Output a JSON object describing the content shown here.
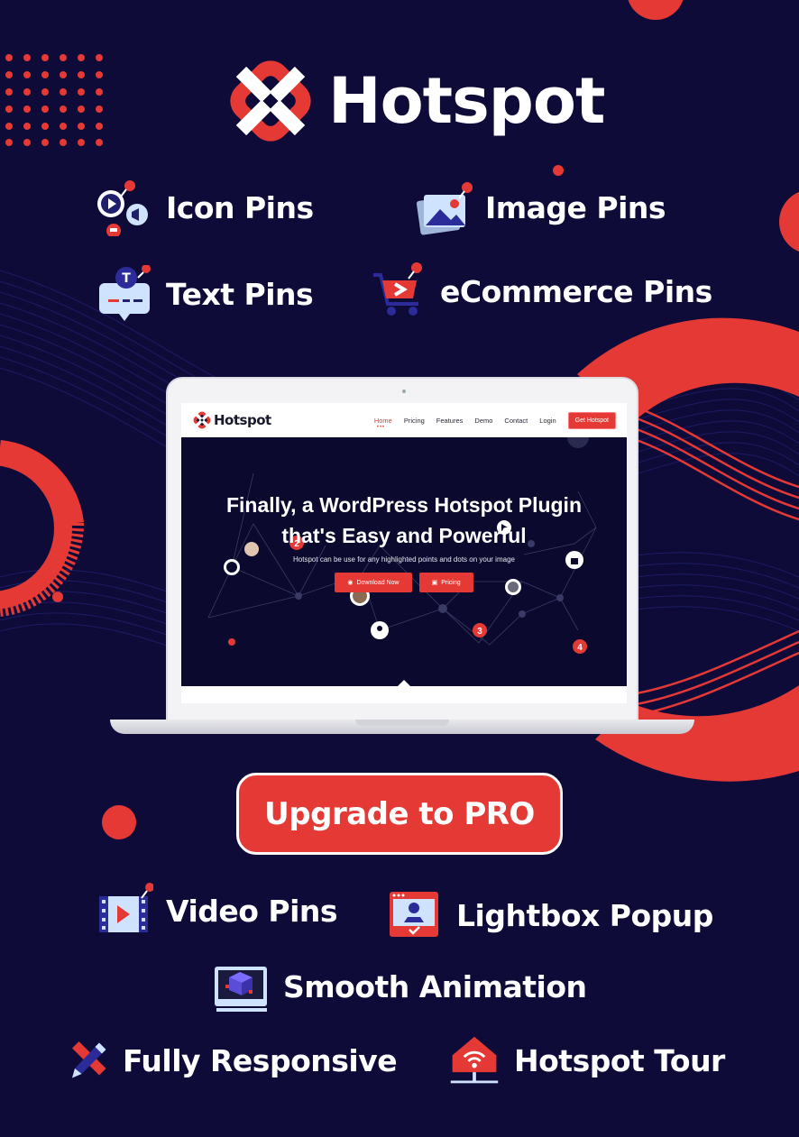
{
  "brand": {
    "name": "Hotspot",
    "accent_color": "#e53935",
    "background_color": "#0e0b38"
  },
  "features_top": [
    {
      "label": "Icon Pins",
      "icon": "icon-pins-icon"
    },
    {
      "label": "Image Pins",
      "icon": "image-pins-icon"
    },
    {
      "label": "Text Pins",
      "icon": "text-pins-icon"
    },
    {
      "label": "eCommerce Pins",
      "icon": "ecommerce-pins-icon"
    }
  ],
  "demo_site": {
    "logo_text": "Hotspot",
    "nav": [
      "Home",
      "Pricing",
      "Features",
      "Demo",
      "Contact",
      "Login"
    ],
    "nav_active": "Home",
    "cta": "Get Hotspot",
    "hero_title_line1": "Finally, a WordPress Hotspot Plugin",
    "hero_title_line2": "that's Easy and Powerful",
    "hero_subtitle": "Hotspot can be use for any highlighted points and dots on your image",
    "btn_download": "Download Now",
    "btn_pricing": "Pricing",
    "pin_numbers": [
      "2",
      "3",
      "4"
    ]
  },
  "upgrade_button": "Upgrade to PRO",
  "features_bottom": [
    {
      "label": "Video Pins",
      "icon": "video-pins-icon"
    },
    {
      "label": "Lightbox Popup",
      "icon": "lightbox-popup-icon"
    },
    {
      "label": "Smooth Animation",
      "icon": "smooth-animation-icon"
    },
    {
      "label": "Fully Responsive",
      "icon": "fully-responsive-icon"
    },
    {
      "label": "Hotspot Tour",
      "icon": "hotspot-tour-icon"
    }
  ]
}
